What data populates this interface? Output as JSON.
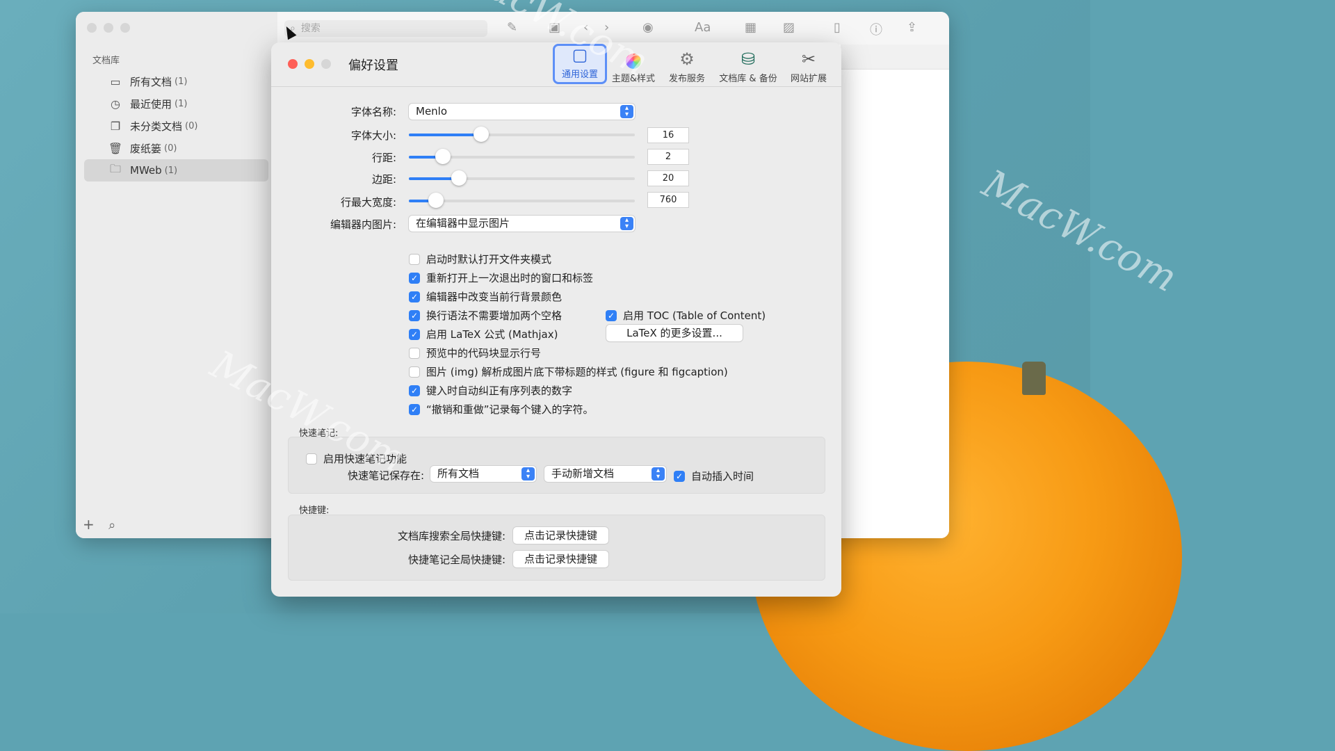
{
  "sidebar": {
    "heading": "文档库",
    "items": [
      {
        "label": "所有文档",
        "count": "(1)",
        "icon": "tray-icon"
      },
      {
        "label": "最近使用",
        "count": "(1)",
        "icon": "clock-icon"
      },
      {
        "label": "未分类文档",
        "count": "(0)",
        "icon": "documents-icon"
      },
      {
        "label": "废纸篓",
        "count": "(0)",
        "icon": "trash-icon"
      },
      {
        "label": "MWeb",
        "count": "(1)",
        "icon": "folder-icon"
      }
    ],
    "add_symbol": "+",
    "search_symbol": "⌕"
  },
  "toolbar": {
    "search_placeholder": "搜索",
    "font_menu": "Aa"
  },
  "prefs": {
    "title": "偏好设置",
    "tabs": [
      {
        "label": "通用设置",
        "icon": "general-icon",
        "active": true
      },
      {
        "label": "主题&样式",
        "icon": "color-wheel-icon",
        "active": false
      },
      {
        "label": "发布服务",
        "icon": "gear-icon",
        "active": false
      },
      {
        "label": "文档库 & 备份",
        "icon": "backup-disk-icon",
        "active": false
      },
      {
        "label": "网站扩展",
        "icon": "tools-icon",
        "active": false
      }
    ],
    "font_name_label": "字体名称:",
    "font_name_value": "Menlo",
    "font_size_label": "字体大小:",
    "font_size_value": "16",
    "font_size_fraction": 0.32,
    "line_spacing_label": "行距:",
    "line_spacing_value": "2",
    "line_spacing_fraction": 0.15,
    "margin_label": "边距:",
    "margin_value": "20",
    "margin_fraction": 0.22,
    "max_width_label": "行最大宽度:",
    "max_width_value": "760",
    "max_width_fraction": 0.12,
    "editor_image_label": "编辑器内图片:",
    "editor_image_value": "在编辑器中显示图片",
    "options": [
      {
        "label": "启动时默认打开文件夹模式",
        "checked": false
      },
      {
        "label": "重新打开上一次退出时的窗口和标签",
        "checked": true
      },
      {
        "label": "编辑器中改变当前行背景颜色",
        "checked": true
      },
      {
        "label": "换行语法不需要增加两个空格",
        "checked": true
      },
      {
        "label": "启用 LaTeX 公式 (Mathjax)",
        "checked": true
      },
      {
        "label": "预览中的代码块显示行号",
        "checked": false
      },
      {
        "label": "图片 (img) 解析成图片底下带标题的样式 (figure 和 figcaption)",
        "checked": false
      },
      {
        "label": "键入时自动纠正有序列表的数字",
        "checked": true
      },
      {
        "label": "“撤销和重做”记录每个键入的字符。",
        "checked": true
      }
    ],
    "toc_label": "启用 TOC (Table of Content)",
    "toc_checked": true,
    "latex_more_button": "LaTeX 的更多设置...",
    "quick_note_section": "快速笔记:",
    "quick_note_enable": "启用快速笔记功能",
    "quick_note_enable_checked": false,
    "quick_note_save_label": "快速笔记保存在:",
    "quick_note_save_value": "所有文档",
    "quick_note_mode_value": "手动新增文档",
    "auto_insert_time": "自动插入时间",
    "auto_insert_time_checked": true,
    "shortcut_section": "快捷键:",
    "library_search_shortcut_label": "文档库搜索全局快捷键:",
    "quick_note_shortcut_label": "快捷笔记全局快捷键:",
    "record_shortcut_button": "点击记录快捷键",
    "record_shortcut_button2": "点击记录快捷键"
  },
  "watermark": "MacW.com",
  "colors": {
    "accent": "#2f7ff6",
    "close": "#fe5f57",
    "minimize": "#febc2e",
    "inactive": "#d6d6d6"
  }
}
